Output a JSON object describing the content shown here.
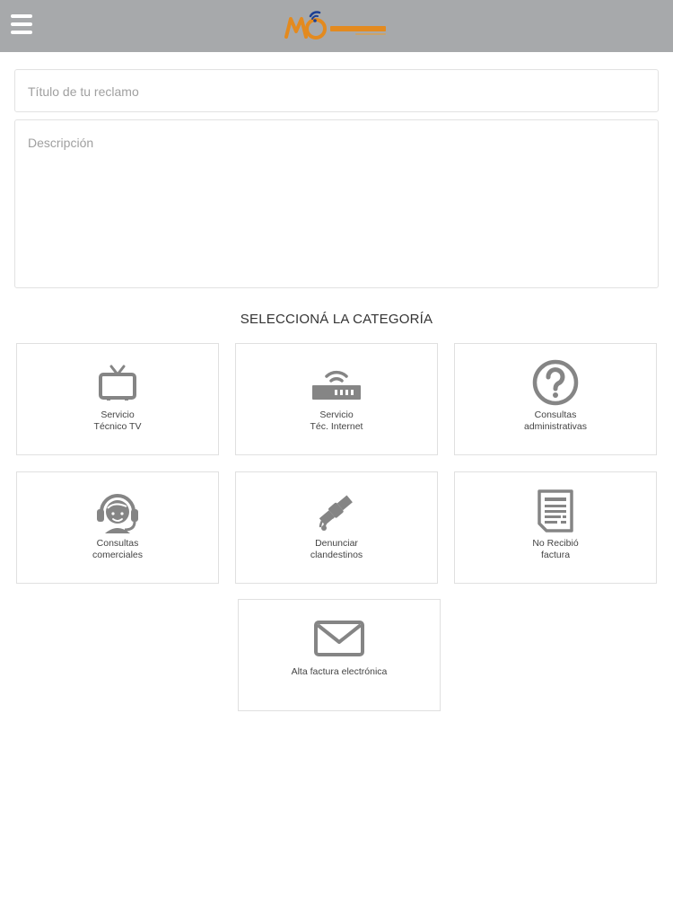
{
  "header": {
    "menu_icon": "hamburger-menu-icon",
    "logo_text": "megavisión"
  },
  "form": {
    "title_placeholder": "Título de tu reclamo",
    "description_placeholder": "Descripción"
  },
  "categories": {
    "heading": "SELECCIONÁ LA CATEGORÍA",
    "items": [
      {
        "label": "Servicio\nTécnico TV",
        "icon": "tv-icon"
      },
      {
        "label": "Servicio\nTéc. Internet",
        "icon": "router-icon"
      },
      {
        "label": "Consultas\nadministrativas",
        "icon": "question-icon"
      },
      {
        "label": "Consultas\ncomerciales",
        "icon": "headset-agent-icon"
      },
      {
        "label": "Denunciar\nclandestinos",
        "icon": "satellite-icon"
      },
      {
        "label": "No Recibió\nfactura",
        "icon": "invoice-document-icon"
      },
      {
        "label": "Alta factura electrónica",
        "icon": "envelope-icon"
      }
    ]
  },
  "colors": {
    "header_bg": "#a7a9ab",
    "icon_gray": "#858585",
    "logo_orange": "#e38a1f",
    "logo_blue": "#1c3f94"
  }
}
